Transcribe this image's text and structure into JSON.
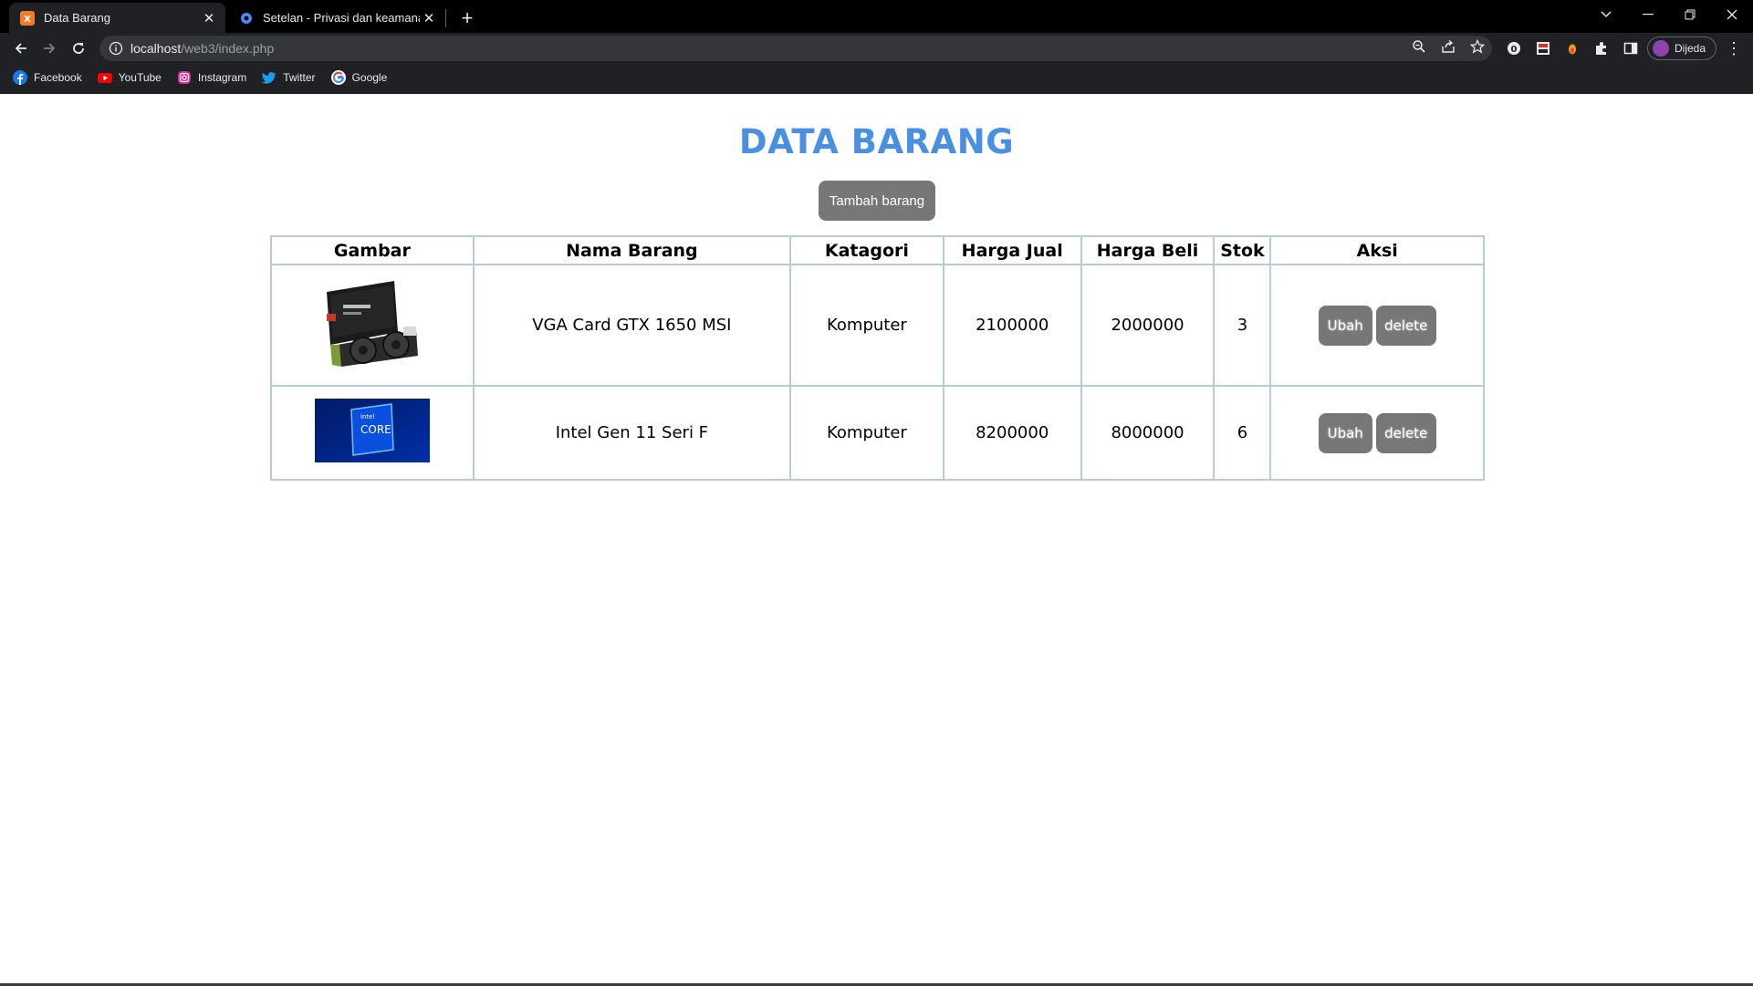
{
  "browser": {
    "tabs": [
      {
        "title": "Data Barang",
        "active": true
      },
      {
        "title": "Setelan - Privasi dan keamanan",
        "active": false
      }
    ],
    "url": {
      "host": "localhost",
      "path": "/web3/index.php"
    },
    "profile_name": "Dijeda",
    "bookmarks": [
      {
        "label": "Facebook",
        "icon": "facebook-icon"
      },
      {
        "label": "YouTube",
        "icon": "youtube-icon"
      },
      {
        "label": "Instagram",
        "icon": "instagram-icon"
      },
      {
        "label": "Twitter",
        "icon": "twitter-icon"
      },
      {
        "label": "Google",
        "icon": "google-icon"
      }
    ]
  },
  "page": {
    "title": "DATA BARANG",
    "add_button": "Tambah barang",
    "colors": {
      "title": "#4a90e2",
      "button": "#777777",
      "border": "#b6cdd6"
    }
  },
  "table": {
    "headers": [
      "Gambar",
      "Nama Barang",
      "Katagori",
      "Harga Jual",
      "Harga Beli",
      "Stok",
      "Aksi"
    ],
    "rows": [
      {
        "image": "graphics-card-image",
        "nama": "VGA Card GTX 1650 MSI",
        "kategori": "Komputer",
        "harga_jual": "2100000",
        "harga_beli": "2000000",
        "stok": "3",
        "ubah": "Ubah",
        "delete": "delete"
      },
      {
        "image": "intel-core-image",
        "nama": "Intel Gen 11 Seri F",
        "kategori": "Komputer",
        "harga_jual": "8200000",
        "harga_beli": "8000000",
        "stok": "6",
        "ubah": "Ubah",
        "delete": "delete"
      }
    ]
  },
  "images": {
    "intel_logo_text_top": "intel",
    "intel_logo_text_main": "CORE"
  }
}
